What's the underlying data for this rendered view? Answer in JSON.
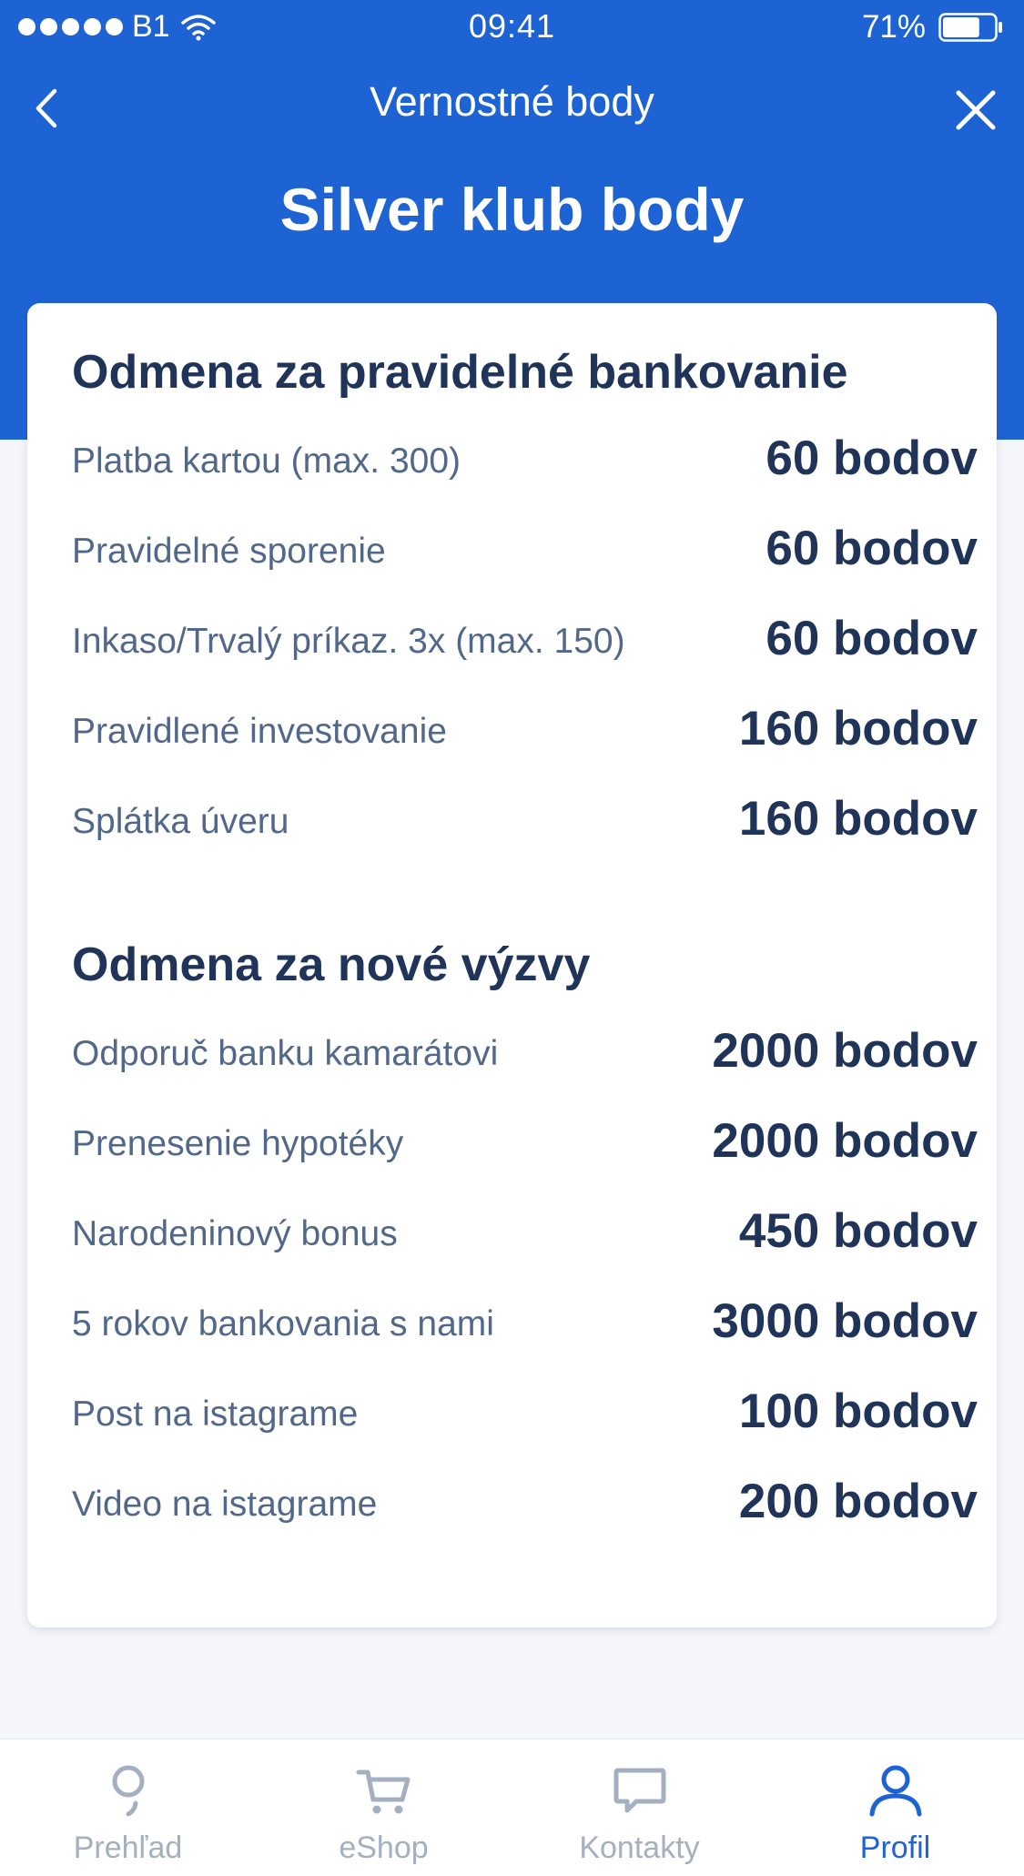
{
  "status_bar": {
    "carrier": "B1",
    "time": "09:41",
    "battery": "71%",
    "battery_level": 0.71
  },
  "nav": {
    "title": "Vernostné body",
    "back_icon": "chevron-left-icon",
    "close_icon": "close-icon"
  },
  "page_title": "Silver klub body",
  "sections": [
    {
      "title": "Odmena za pravidelné bankovanie",
      "rows": [
        {
          "label": "Platba kartou  (max. 300)",
          "value": "60 bodov"
        },
        {
          "label": "Pravidelné sporenie",
          "value": "60 bodov"
        },
        {
          "label": "Inkaso/Trvalý príkaz. 3x (max. 150)",
          "value": "60 bodov"
        },
        {
          "label": "Pravidlené investovanie",
          "value": "160 bodov"
        },
        {
          "label": "Splátka úveru",
          "value": "160 bodov"
        }
      ]
    },
    {
      "title": "Odmena za nové výzvy",
      "rows": [
        {
          "label": "Odporuč banku kamarátovi",
          "value": "2000 bodov"
        },
        {
          "label": "Prenesenie hypotéky",
          "value": "2000 bodov"
        },
        {
          "label": "Narodeninový bonus",
          "value": "450 bodov"
        },
        {
          "label": "5 rokov bankovania s nami",
          "value": "3000 bodov"
        },
        {
          "label": "Post na istagrame",
          "value": "100 bodov"
        },
        {
          "label": "Video na istagrame",
          "value": "200 bodov"
        }
      ]
    }
  ],
  "tab_bar": {
    "tabs": [
      {
        "label": "Prehľad",
        "icon": "overview-icon",
        "active": false
      },
      {
        "label": "eShop",
        "icon": "cart-icon",
        "active": false
      },
      {
        "label": "Kontakty",
        "icon": "chat-bubble-icon",
        "active": false
      },
      {
        "label": "Profil",
        "icon": "person-icon",
        "active": true
      }
    ]
  },
  "colors": {
    "brand_blue": "#1e63d4",
    "heading_text": "#1f3458",
    "label_text": "#51688a",
    "inactive_tab": "#a4b0c2",
    "background": "#f4f6f9"
  }
}
